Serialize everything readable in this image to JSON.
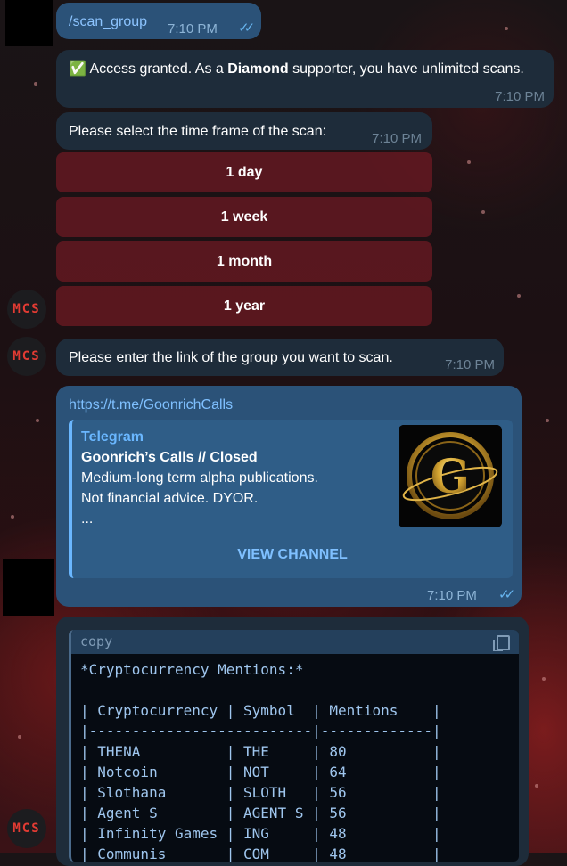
{
  "messages": {
    "cmd": {
      "text": "/scan_group",
      "time": "7:10 PM"
    },
    "access": {
      "emoji": "✅",
      "pre": "Access granted. As a ",
      "bold": "Diamond",
      "post": " supporter, you have unlimited scans.",
      "time": "7:10 PM"
    },
    "timeframe": {
      "text": "Please select the time frame of the scan:",
      "time": "7:10 PM"
    },
    "enter_link": {
      "text": "Please enter the link of the group you want to scan.",
      "time": "7:10 PM"
    },
    "link_msg": {
      "url": "https://t.me/GoonrichCalls",
      "time": "7:10 PM",
      "preview": {
        "site": "Telegram",
        "title": "Goonrich’s Calls // Closed",
        "desc1": "Medium-long term alpha publications.",
        "desc2": "Not financial advice. DYOR.",
        "desc3": "...",
        "button": "VIEW CHANNEL",
        "logo_letter": "G"
      }
    }
  },
  "keyboard": [
    "1 day",
    "1 week",
    "1 month",
    "1 year"
  ],
  "avatar_label": "MCS",
  "code": {
    "header": "copy",
    "title": "*Cryptocurrency Mentions:*",
    "columns": [
      "Cryptocurrency",
      "Symbol",
      "Mentions"
    ],
    "rows": [
      [
        "THENA",
        "THE",
        "80"
      ],
      [
        "Notcoin",
        "NOT",
        "64"
      ],
      [
        "Slothana",
        "SLOTH",
        "56"
      ],
      [
        "Agent S",
        "AGENT S",
        "56"
      ],
      [
        "Infinity Games",
        "ING",
        "48"
      ],
      [
        "Communis",
        "COM",
        "48"
      ]
    ]
  },
  "colors": {
    "out_bubble": "#2b5278",
    "in_bubble": "#1e2c3a",
    "keyboard_button": "#6e1923",
    "avatar_text": "#e23b33",
    "link": "#7fc0ff"
  }
}
